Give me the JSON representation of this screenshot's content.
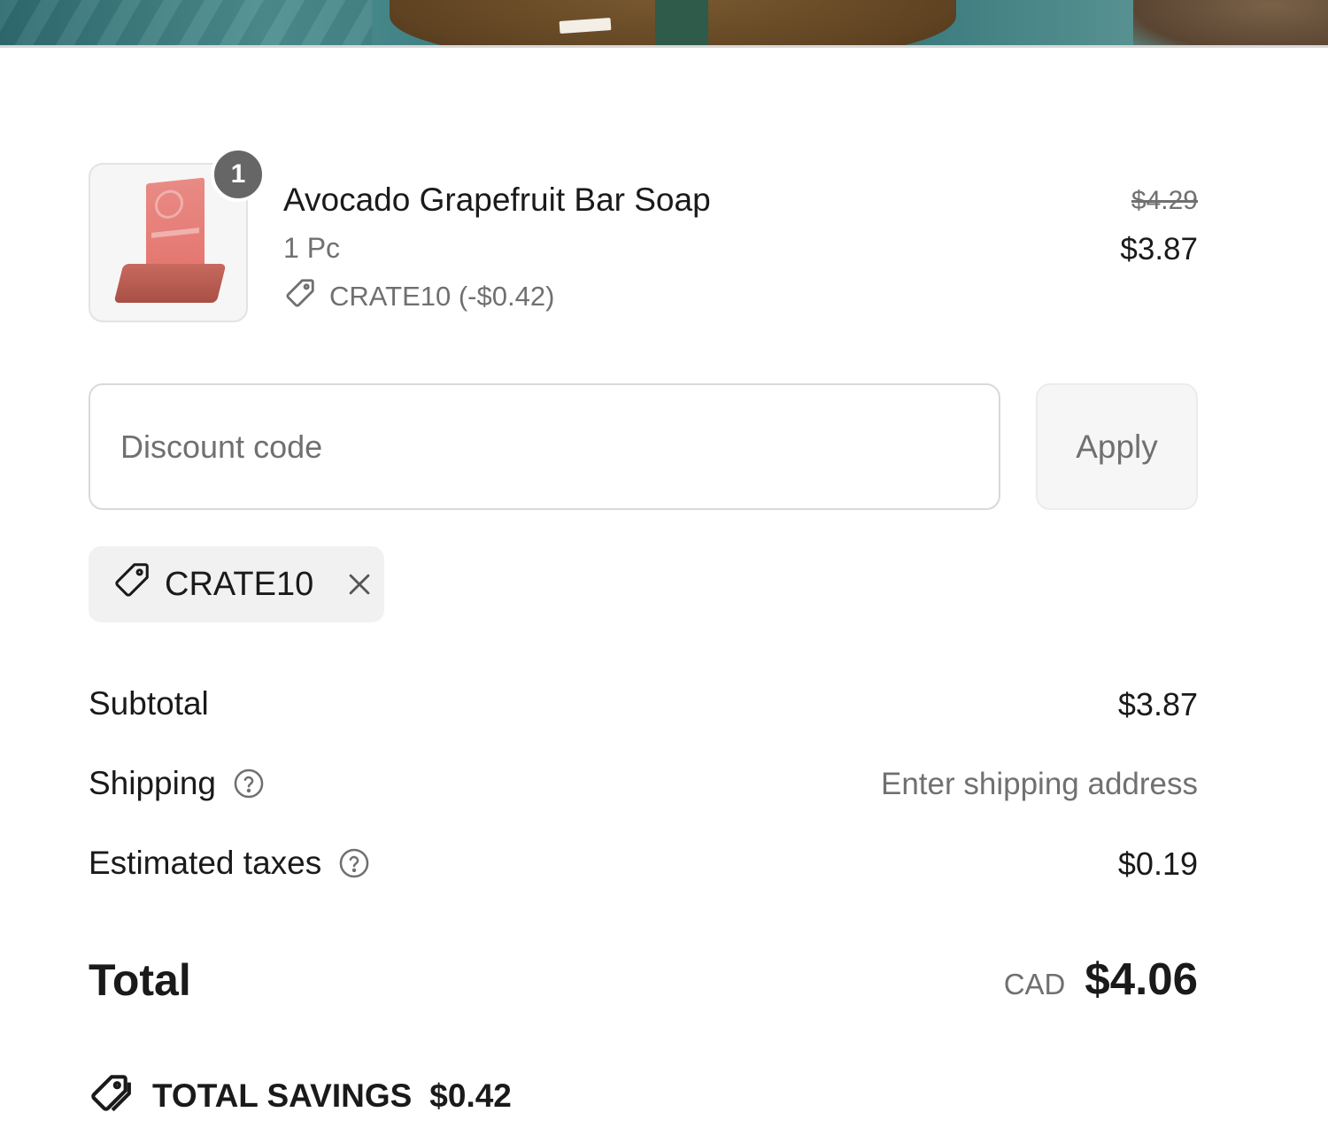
{
  "line_item": {
    "quantity": "1",
    "title": "Avocado Grapefruit Bar Soap",
    "variant": "1 Pc",
    "discount_allocation": "CRATE10 (-$0.42)",
    "price_original": "$4.29",
    "price_current": "$3.87"
  },
  "discount": {
    "placeholder": "Discount code",
    "value": "",
    "apply_label": "Apply",
    "applied_code": "CRATE10"
  },
  "summary": {
    "subtotal_label": "Subtotal",
    "subtotal_value": "$3.87",
    "shipping_label": "Shipping",
    "shipping_value": "Enter shipping address",
    "taxes_label": "Estimated taxes",
    "taxes_value": "$0.19",
    "total_label": "Total",
    "total_currency": "CAD",
    "total_value": "$4.06",
    "savings_label": "TOTAL SAVINGS",
    "savings_value": "$0.42"
  },
  "icons": {
    "tag": "tag-icon",
    "close": "close-icon",
    "help": "question-circle-icon",
    "savings": "savings-tag-icon"
  },
  "colors": {
    "text": "#1a1a1a",
    "muted": "#707070",
    "badge": "#666666",
    "border": "#d9d9d9",
    "chip_bg": "#f1f1f1"
  }
}
